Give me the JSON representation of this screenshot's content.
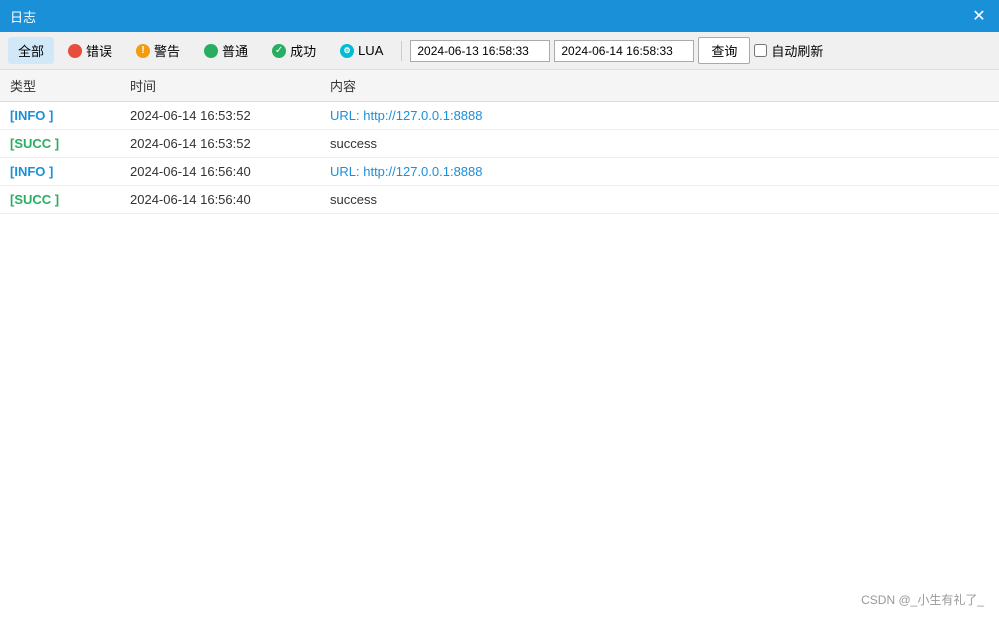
{
  "titleBar": {
    "title": "日志",
    "closeLabel": "✕"
  },
  "toolbar": {
    "allLabel": "全部",
    "errorLabel": "错误",
    "warnLabel": "警告",
    "normalLabel": "普通",
    "successLabel": "成功",
    "luaLabel": "LUA",
    "startDatetime": "2024-06-13 16:58:33",
    "endDatetime": "2024-06-14 16:58:33",
    "queryLabel": "查询",
    "autoRefreshLabel": "自动刷新"
  },
  "tableHeader": {
    "typeCol": "类型",
    "timeCol": "时间",
    "contentCol": "内容"
  },
  "rows": [
    {
      "type": "[INFO ]",
      "typeClass": "type-info",
      "time": "2024-06-14 16:53:52",
      "content": "URL: http://127.0.0.1:8888",
      "contentClass": "content-cell"
    },
    {
      "type": "[SUCC ]",
      "typeClass": "type-succ",
      "time": "2024-06-14 16:53:52",
      "content": "success",
      "contentClass": "content-plain"
    },
    {
      "type": "[INFO ]",
      "typeClass": "type-info",
      "time": "2024-06-14 16:56:40",
      "content": "URL: http://127.0.0.1:8888",
      "contentClass": "content-cell"
    },
    {
      "type": "[SUCC ]",
      "typeClass": "type-succ",
      "time": "2024-06-14 16:56:40",
      "content": "success",
      "contentClass": "content-plain"
    }
  ],
  "footer": {
    "watermark": "CSDN @_小生有礼了_"
  }
}
